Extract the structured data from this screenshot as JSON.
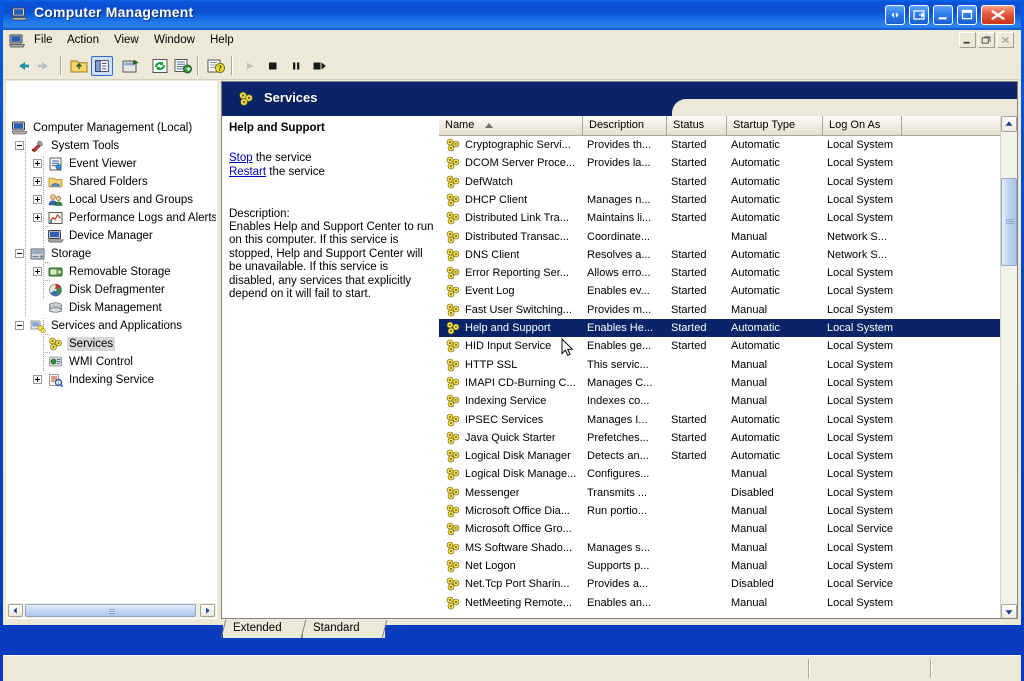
{
  "window": {
    "title": "Computer Management",
    "icon": "computer-icon",
    "buttons": {
      "restore_all": "restore-all-button",
      "mdi_restore": "mdi-restore-button",
      "minimize": "minimize-button",
      "maximize": "maximize-button",
      "close": "close-button"
    },
    "mdi_child": {
      "minimize": "mdi-child-minimize",
      "restore": "mdi-child-restore",
      "close": "mdi-child-close"
    }
  },
  "menubar": {
    "icon": "console-icon",
    "items": [
      {
        "label": "File"
      },
      {
        "label": "Action"
      },
      {
        "label": "View"
      },
      {
        "label": "Window"
      },
      {
        "label": "Help"
      }
    ]
  },
  "toolbar": {
    "items": [
      {
        "name": "back-button",
        "icon": "arrow-left-icon",
        "enabled": false
      },
      {
        "name": "forward-button",
        "icon": "arrow-right-icon",
        "enabled": false
      },
      {
        "name": "up-one-level-button",
        "icon": "folder-up-icon",
        "enabled": true
      },
      {
        "name": "show-hide-tree-button",
        "icon": "console-tree-icon",
        "enabled": true,
        "pressed": true
      },
      {
        "name": "properties-button",
        "icon": "properties-icon",
        "enabled": true
      },
      {
        "name": "refresh-button",
        "icon": "refresh-icon",
        "enabled": true
      },
      {
        "name": "export-list-button",
        "icon": "export-list-icon",
        "enabled": true
      },
      {
        "name": "help-button",
        "icon": "help-question-icon",
        "enabled": true
      },
      {
        "name": "start-service-button",
        "icon": "play-icon",
        "enabled": false
      },
      {
        "name": "stop-service-button",
        "icon": "stop-icon",
        "enabled": true
      },
      {
        "name": "pause-service-button",
        "icon": "pause-icon",
        "enabled": true
      },
      {
        "name": "restart-service-button",
        "icon": "restart-icon",
        "enabled": true
      }
    ]
  },
  "tree": {
    "nodes": [
      {
        "label": "Computer Management (Local)",
        "depth": 0,
        "icon": "computer-icon",
        "expander": "none",
        "selected": false
      },
      {
        "label": "System Tools",
        "depth": 1,
        "icon": "system-tools-icon",
        "expander": "minus",
        "selected": false
      },
      {
        "label": "Event Viewer",
        "depth": 2,
        "icon": "event-viewer-icon",
        "expander": "plus",
        "selected": false
      },
      {
        "label": "Shared Folders",
        "depth": 2,
        "icon": "shared-folders-icon",
        "expander": "plus",
        "selected": false
      },
      {
        "label": "Local Users and Groups",
        "depth": 2,
        "icon": "local-users-icon",
        "expander": "plus",
        "selected": false
      },
      {
        "label": "Performance Logs and Alerts",
        "depth": 2,
        "icon": "performance-logs-icon",
        "expander": "plus",
        "selected": false
      },
      {
        "label": "Device Manager",
        "depth": 2,
        "icon": "device-manager-icon",
        "expander": "none",
        "selected": false
      },
      {
        "label": "Storage",
        "depth": 1,
        "icon": "storage-icon",
        "expander": "minus",
        "selected": false
      },
      {
        "label": "Removable Storage",
        "depth": 2,
        "icon": "removable-storage-icon",
        "expander": "plus",
        "selected": false
      },
      {
        "label": "Disk Defragmenter",
        "depth": 2,
        "icon": "disk-defragmenter-icon",
        "expander": "none",
        "selected": false
      },
      {
        "label": "Disk Management",
        "depth": 2,
        "icon": "disk-management-icon",
        "expander": "none",
        "selected": false
      },
      {
        "label": "Services and Applications",
        "depth": 1,
        "icon": "services-apps-icon",
        "expander": "minus",
        "selected": false
      },
      {
        "label": "Services",
        "depth": 2,
        "icon": "services-gear-icon",
        "expander": "none",
        "selected": true
      },
      {
        "label": "WMI Control",
        "depth": 2,
        "icon": "wmi-control-icon",
        "expander": "none",
        "selected": false
      },
      {
        "label": "Indexing Service",
        "depth": 2,
        "icon": "indexing-service-icon",
        "expander": "plus",
        "selected": false
      }
    ]
  },
  "results_header": {
    "icon": "services-gear-icon",
    "title": "Services"
  },
  "detail": {
    "title": "Help and Support",
    "actions": [
      {
        "link": "Stop",
        "suffix": " the service"
      },
      {
        "link": "Restart",
        "suffix": " the service"
      }
    ],
    "description_label": "Description:",
    "description": "Enables Help and Support Center to run on this computer. If this service is stopped, Help and Support Center will be unavailable. If this service is disabled, any services that explicitly depend on it will fail to start."
  },
  "list": {
    "columns": [
      {
        "label": "Name",
        "sorted": true,
        "sort_dir": "asc"
      },
      {
        "label": "Description",
        "sorted": false
      },
      {
        "label": "Status",
        "sorted": false
      },
      {
        "label": "Startup Type",
        "sorted": false
      },
      {
        "label": "Log On As",
        "sorted": false
      }
    ],
    "rows": [
      {
        "name": "Cryptographic Servi...",
        "description": "Provides th...",
        "status": "Started",
        "startup": "Automatic",
        "logon": "Local System",
        "selected": false
      },
      {
        "name": "DCOM Server Proce...",
        "description": "Provides la...",
        "status": "Started",
        "startup": "Automatic",
        "logon": "Local System",
        "selected": false
      },
      {
        "name": "DefWatch",
        "description": "",
        "status": "Started",
        "startup": "Automatic",
        "logon": "Local System",
        "selected": false
      },
      {
        "name": "DHCP Client",
        "description": "Manages n...",
        "status": "Started",
        "startup": "Automatic",
        "logon": "Local System",
        "selected": false
      },
      {
        "name": "Distributed Link Tra...",
        "description": "Maintains li...",
        "status": "Started",
        "startup": "Automatic",
        "logon": "Local System",
        "selected": false
      },
      {
        "name": "Distributed Transac...",
        "description": "Coordinate...",
        "status": "",
        "startup": "Manual",
        "logon": "Network S...",
        "selected": false
      },
      {
        "name": "DNS Client",
        "description": "Resolves a...",
        "status": "Started",
        "startup": "Automatic",
        "logon": "Network S...",
        "selected": false
      },
      {
        "name": "Error Reporting Ser...",
        "description": "Allows erro...",
        "status": "Started",
        "startup": "Automatic",
        "logon": "Local System",
        "selected": false
      },
      {
        "name": "Event Log",
        "description": "Enables ev...",
        "status": "Started",
        "startup": "Automatic",
        "logon": "Local System",
        "selected": false
      },
      {
        "name": "Fast User Switching...",
        "description": "Provides m...",
        "status": "Started",
        "startup": "Manual",
        "logon": "Local System",
        "selected": false
      },
      {
        "name": "Help and Support",
        "description": "Enables He...",
        "status": "Started",
        "startup": "Automatic",
        "logon": "Local System",
        "selected": true
      },
      {
        "name": "HID Input Service",
        "description": "Enables ge...",
        "status": "Started",
        "startup": "Automatic",
        "logon": "Local System",
        "selected": false
      },
      {
        "name": "HTTP SSL",
        "description": "This servic...",
        "status": "",
        "startup": "Manual",
        "logon": "Local System",
        "selected": false
      },
      {
        "name": "IMAPI CD-Burning C...",
        "description": "Manages C...",
        "status": "",
        "startup": "Manual",
        "logon": "Local System",
        "selected": false
      },
      {
        "name": "Indexing Service",
        "description": "Indexes co...",
        "status": "",
        "startup": "Manual",
        "logon": "Local System",
        "selected": false
      },
      {
        "name": "IPSEC Services",
        "description": "Manages I...",
        "status": "Started",
        "startup": "Automatic",
        "logon": "Local System",
        "selected": false
      },
      {
        "name": "Java Quick Starter",
        "description": "Prefetches...",
        "status": "Started",
        "startup": "Automatic",
        "logon": "Local System",
        "selected": false
      },
      {
        "name": "Logical Disk Manager",
        "description": "Detects an...",
        "status": "Started",
        "startup": "Automatic",
        "logon": "Local System",
        "selected": false
      },
      {
        "name": "Logical Disk Manage...",
        "description": "Configures...",
        "status": "",
        "startup": "Manual",
        "logon": "Local System",
        "selected": false
      },
      {
        "name": "Messenger",
        "description": "Transmits ...",
        "status": "",
        "startup": "Disabled",
        "logon": "Local System",
        "selected": false
      },
      {
        "name": "Microsoft Office Dia...",
        "description": "Run portio...",
        "status": "",
        "startup": "Manual",
        "logon": "Local System",
        "selected": false
      },
      {
        "name": "Microsoft Office Gro...",
        "description": "",
        "status": "",
        "startup": "Manual",
        "logon": "Local Service",
        "selected": false
      },
      {
        "name": "MS Software Shado...",
        "description": "Manages s...",
        "status": "",
        "startup": "Manual",
        "logon": "Local System",
        "selected": false
      },
      {
        "name": "Net Logon",
        "description": "Supports p...",
        "status": "",
        "startup": "Manual",
        "logon": "Local System",
        "selected": false
      },
      {
        "name": "Net.Tcp Port Sharin...",
        "description": "Provides a...",
        "status": "",
        "startup": "Disabled",
        "logon": "Local Service",
        "selected": false
      },
      {
        "name": "NetMeeting Remote...",
        "description": "Enables an...",
        "status": "",
        "startup": "Manual",
        "logon": "Local System",
        "selected": false
      }
    ]
  },
  "tabs": [
    {
      "label": "Extended",
      "active": true
    },
    {
      "label": "Standard",
      "active": false
    }
  ],
  "scrollbars": {
    "vertical": {
      "up": "scroll-up-arrow",
      "down": "scroll-down-arrow"
    },
    "horizontal": {
      "left": "scroll-left-arrow",
      "right": "scroll-right-arrow"
    }
  },
  "statusbar": {
    "text": ""
  },
  "colors": {
    "title_blue": "#0a54d8",
    "selection_blue": "#0a246a",
    "face": "#ece9d8",
    "link": "#0000c0"
  }
}
